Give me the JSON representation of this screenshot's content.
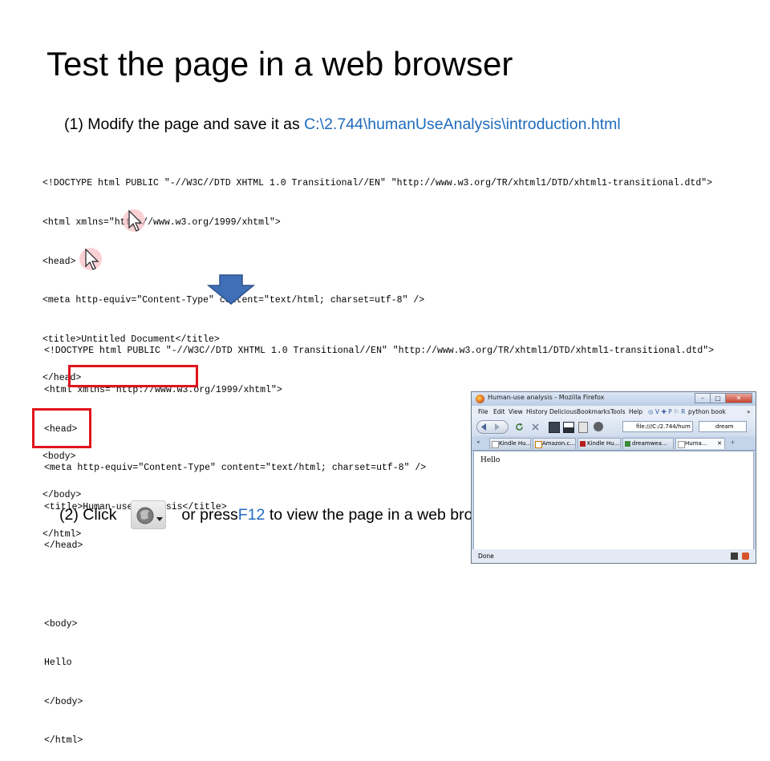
{
  "slide": {
    "title": "Test the page in a web browser",
    "step1": {
      "prefix": "(1) Modify the page and save it as ",
      "path": "C:\\2.744\\humanUseAnalysis\\introduction.html"
    },
    "code_before": [
      "<!DOCTYPE html PUBLIC \"-//W3C//DTD XHTML 1.0 Transitional//EN\" \"http://www.w3.org/TR/xhtml1/DTD/xhtml1-transitional.dtd\">",
      "<html xmlns=\"http://www.w3.org/1999/xhtml\">",
      "<head>",
      "<meta http-equiv=\"Content-Type\" content=\"text/html; charset=utf-8\" />",
      "<title>Untitled Document</title>",
      "</head>",
      "",
      "<body>",
      "</body>",
      "</html>"
    ],
    "code_after": [
      "<!DOCTYPE html PUBLIC \"-//W3C//DTD XHTML 1.0 Transitional//EN\" \"http://www.w3.org/TR/xhtml1/DTD/xhtml1-transitional.dtd\">",
      "<html xmlns=\"http://www.w3.org/1999/xhtml\">",
      "<head>",
      "<meta http-equiv=\"Content-Type\" content=\"text/html; charset=utf-8\" />",
      "<title>Human-use analysis</title>",
      "</head>",
      "",
      "<body>",
      "Hello",
      "</body>",
      "</html>"
    ],
    "step2": {
      "prefix": "(2) Click",
      "middle": "or press ",
      "key": "F12",
      "suffix": " to view the page in a web browser."
    }
  },
  "browser": {
    "window_title": "Human-use analysis - Mozilla Firefox",
    "menu": [
      "File",
      "Edit",
      "View",
      "History",
      "Delicious",
      "Bookmarks",
      "Tools",
      "Help"
    ],
    "bookmark_label": "python book",
    "url": "file:///C:/2.744/hum",
    "search_text": "dream",
    "tabs": [
      "Kindle Hu...",
      "Amazon.c...",
      "Kindle Hu...",
      "dreamwea...",
      "Huma..."
    ],
    "page_text": "Hello",
    "status": "Done"
  },
  "colors": {
    "accent_blue": "#1f6bbd",
    "highlight_red": "#e0141c",
    "arrow_blue": "#3f6fb6"
  },
  "icons": {
    "preview_button": "browser-preview-icon",
    "cursor": "mouse-pointer-icon",
    "arrow": "down-arrow-icon"
  }
}
